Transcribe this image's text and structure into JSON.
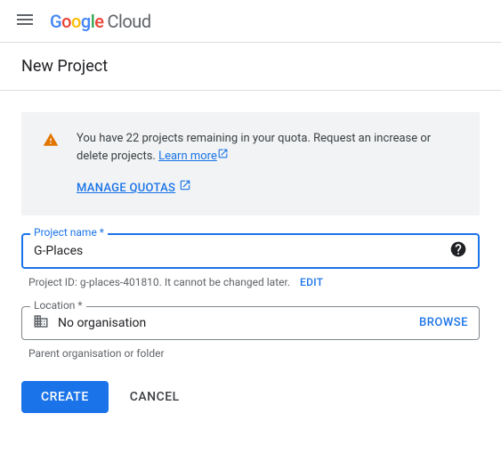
{
  "header": {
    "logo_cloud": "Cloud"
  },
  "title": "New Project",
  "info": {
    "quota_text": "You have 22 projects remaining in your quota. Request an increase or delete projects.",
    "learn_more": "Learn more",
    "manage_quotas": "MANAGE QUOTAS"
  },
  "project_name": {
    "label": "Project name *",
    "value": "G-Places",
    "hint_prefix": "Project ID: ",
    "project_id": "g-places-401810",
    "hint_suffix": ". It cannot be changed later.",
    "edit": "EDIT"
  },
  "location": {
    "label": "Location *",
    "value": "No organisation",
    "browse": "BROWSE",
    "helper": "Parent organisation or folder"
  },
  "actions": {
    "create": "CREATE",
    "cancel": "CANCEL"
  }
}
